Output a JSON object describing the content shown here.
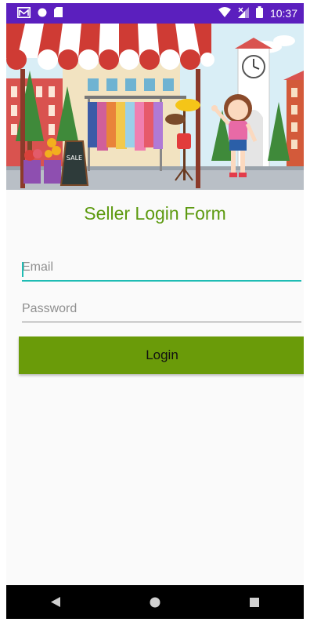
{
  "status_bar": {
    "time": "10:37",
    "icons": [
      "gmail-icon",
      "circle-notification-icon",
      "sd-card-icon",
      "wifi-icon",
      "signal-icon",
      "battery-icon"
    ],
    "background": "#5b1fbe"
  },
  "hero": {
    "image": "shop-illustration",
    "sign_text": "SALE"
  },
  "form": {
    "title": "Seller Login Form",
    "email": {
      "placeholder": "Email",
      "value": ""
    },
    "password": {
      "placeholder": "Password",
      "value": ""
    },
    "login_label": "Login"
  },
  "nav_bar": {
    "buttons": [
      "back-icon",
      "home-icon",
      "recents-icon"
    ]
  },
  "colors": {
    "title": "#5d9a10",
    "button": "#6a9b09",
    "focus_underline": "#1fbcb4",
    "status_bar": "#5b1fbe"
  }
}
